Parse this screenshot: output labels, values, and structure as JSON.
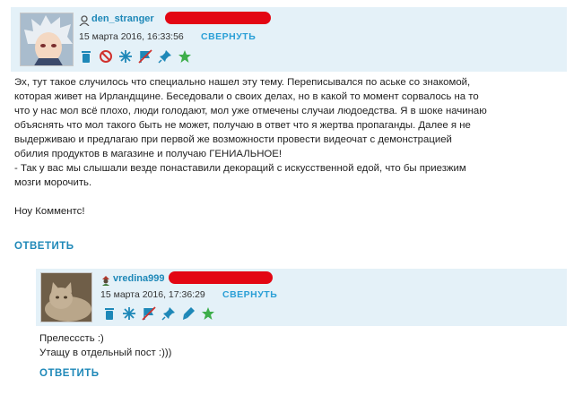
{
  "comments": [
    {
      "username": "den_stranger",
      "timestamp": "15 марта 2016, 16:33:56",
      "collapse_label": "СВЕРНУТЬ",
      "toolbar": [
        "trash-icon",
        "ban-icon",
        "snowflake-icon",
        "strikethrough-flag-icon",
        "pin-icon",
        "star-icon"
      ],
      "body_lines": [
        "Эх, тут такое случилось что специально нашел эту тему. Переписывался по аське со знакомой,",
        "которая живет на Ирландщине. Беседовали о своих делах, но в какой то момент сорвалось на то",
        "что у нас мол всё плохо, люди голодают, мол уже отмечены случаи людоедства. Я в шоке начинаю",
        "объяснять что мол такого быть не может, получаю в ответ что я жертва пропаганды. Далее я не",
        "выдерживаю и предлагаю при первой же возможности провести видеочат с демонстрацией",
        "обилия продуктов в магазине и получаю ГЕНИАЛЬНОЕ!",
        "- Так у вас мы слышали везде понаставили декораций с искусственной едой, что бы приезжим",
        "мозги морочить.",
        "",
        "Ноу Комментс!"
      ],
      "reply_label": "ОТВЕТИТЬ"
    },
    {
      "username": "vredina999",
      "timestamp": "15 марта 2016, 17:36:29",
      "collapse_label": "СВЕРНУТЬ",
      "toolbar": [
        "trash-icon",
        "snowflake-icon",
        "strikethrough-flag-icon",
        "pin-icon",
        "marker-icon",
        "star-icon"
      ],
      "body_lines": [
        "Прелесссть :)",
        "Утащу в отдельный пост :)))"
      ],
      "reply_label": "ОТВЕТИТЬ"
    }
  ],
  "colors": {
    "header_bg": "#e4f1f8",
    "link": "#1e88b8",
    "redaction": "#e30613",
    "icon_blue": "#1e88b8",
    "icon_red": "#d0312d",
    "icon_green": "#3dae4a"
  }
}
